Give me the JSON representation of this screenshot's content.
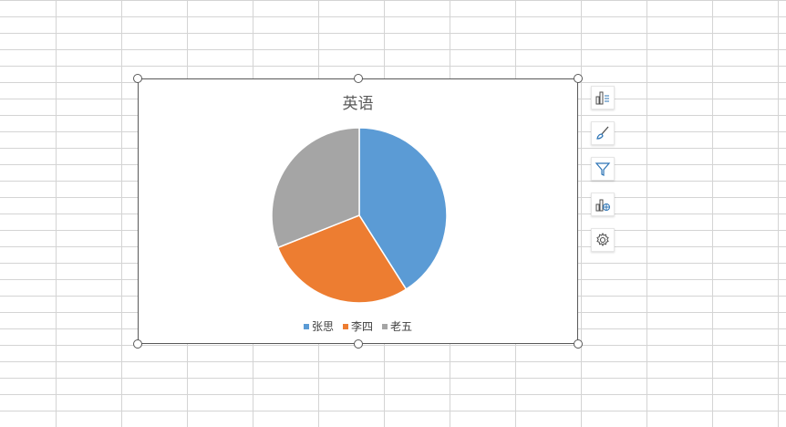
{
  "chart_data": {
    "type": "pie",
    "title": "英语",
    "categories": [
      "张思",
      "李四",
      "老五"
    ],
    "values": [
      41,
      28,
      31
    ],
    "colors": [
      "#5b9bd5",
      "#ed7d31",
      "#a5a5a5"
    ],
    "legend_position": "bottom"
  },
  "side_toolbar": {
    "buttons": [
      {
        "icon": "chart-elements-icon"
      },
      {
        "icon": "chart-style-brush-icon"
      },
      {
        "icon": "chart-filter-icon"
      },
      {
        "icon": "chart-type-icon"
      },
      {
        "icon": "settings-gear-icon"
      }
    ]
  }
}
